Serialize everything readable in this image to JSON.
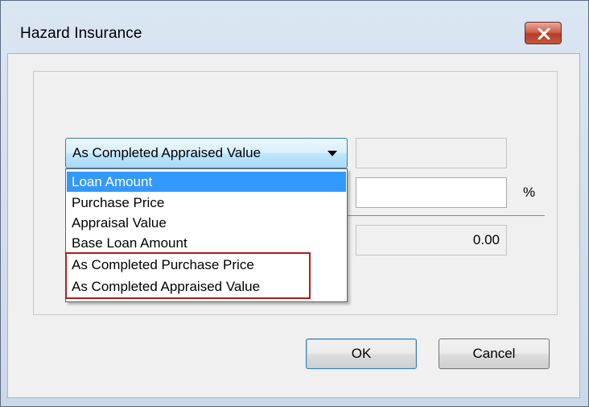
{
  "window": {
    "title": "Hazard Insurance",
    "close_icon": "close-icon"
  },
  "form": {
    "basis_combo": {
      "selected_value": "As Completed Appraised Value",
      "options": [
        "Loan Amount",
        "Purchase Price",
        "Appraisal Value",
        "Base Loan Amount",
        "As Completed Purchase Price",
        "As Completed Appraised Value"
      ],
      "highlighted_option": "Loan Amount"
    },
    "amount_field": {
      "value": ""
    },
    "percent_field": {
      "value": ""
    },
    "percent_symbol": "%",
    "total_field": {
      "value": "0.00"
    }
  },
  "buttons": {
    "ok_label": "OK",
    "cancel_label": "Cancel"
  },
  "colors": {
    "selection": "#3399ff",
    "callout_border": "#b01c1c",
    "close_button": "#c7563f"
  }
}
